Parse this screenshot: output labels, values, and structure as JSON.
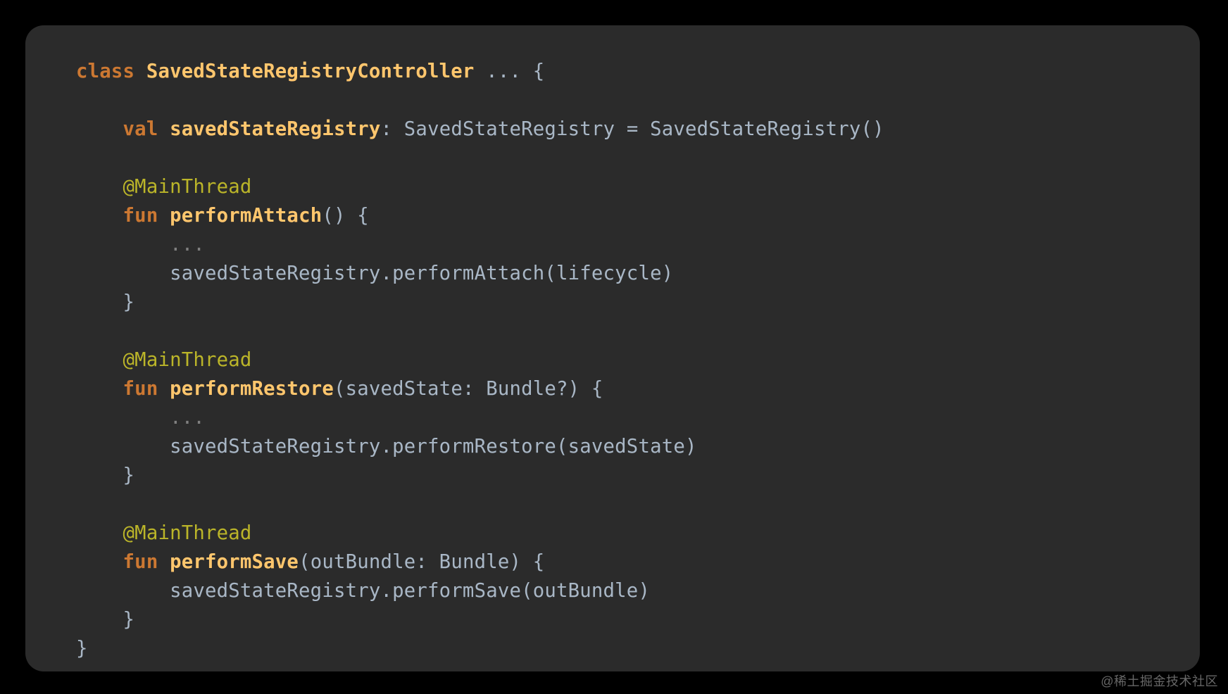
{
  "code": {
    "line1": {
      "class_kw": "class",
      "class_name": "SavedStateRegistryController",
      "ellipsis": " ... ",
      "open_brace": "{"
    },
    "prop": {
      "val_kw": "val",
      "name": "savedStateRegistry",
      "colon": ": ",
      "type": "SavedStateRegistry",
      "eq": " = ",
      "ctor": "SavedStateRegistry()"
    },
    "anno": "@MainThread",
    "fun_kw": "fun",
    "attach": {
      "name": "performAttach",
      "params": "() {",
      "body_dots": "...",
      "call": "savedStateRegistry.performAttach(lifecycle)",
      "close": "}"
    },
    "restore": {
      "name": "performRestore",
      "params": "(savedState: Bundle?) {",
      "body_dots": "...",
      "call": "savedStateRegistry.performRestore(savedState)",
      "close": "}"
    },
    "save": {
      "name": "performSave",
      "params": "(outBundle: Bundle) {",
      "call": "savedStateRegistry.performSave(outBundle)",
      "close": "}"
    },
    "class_close": "}"
  },
  "indent": {
    "i1": "    ",
    "i2": "        "
  },
  "watermark": "@稀土掘金技术社区"
}
